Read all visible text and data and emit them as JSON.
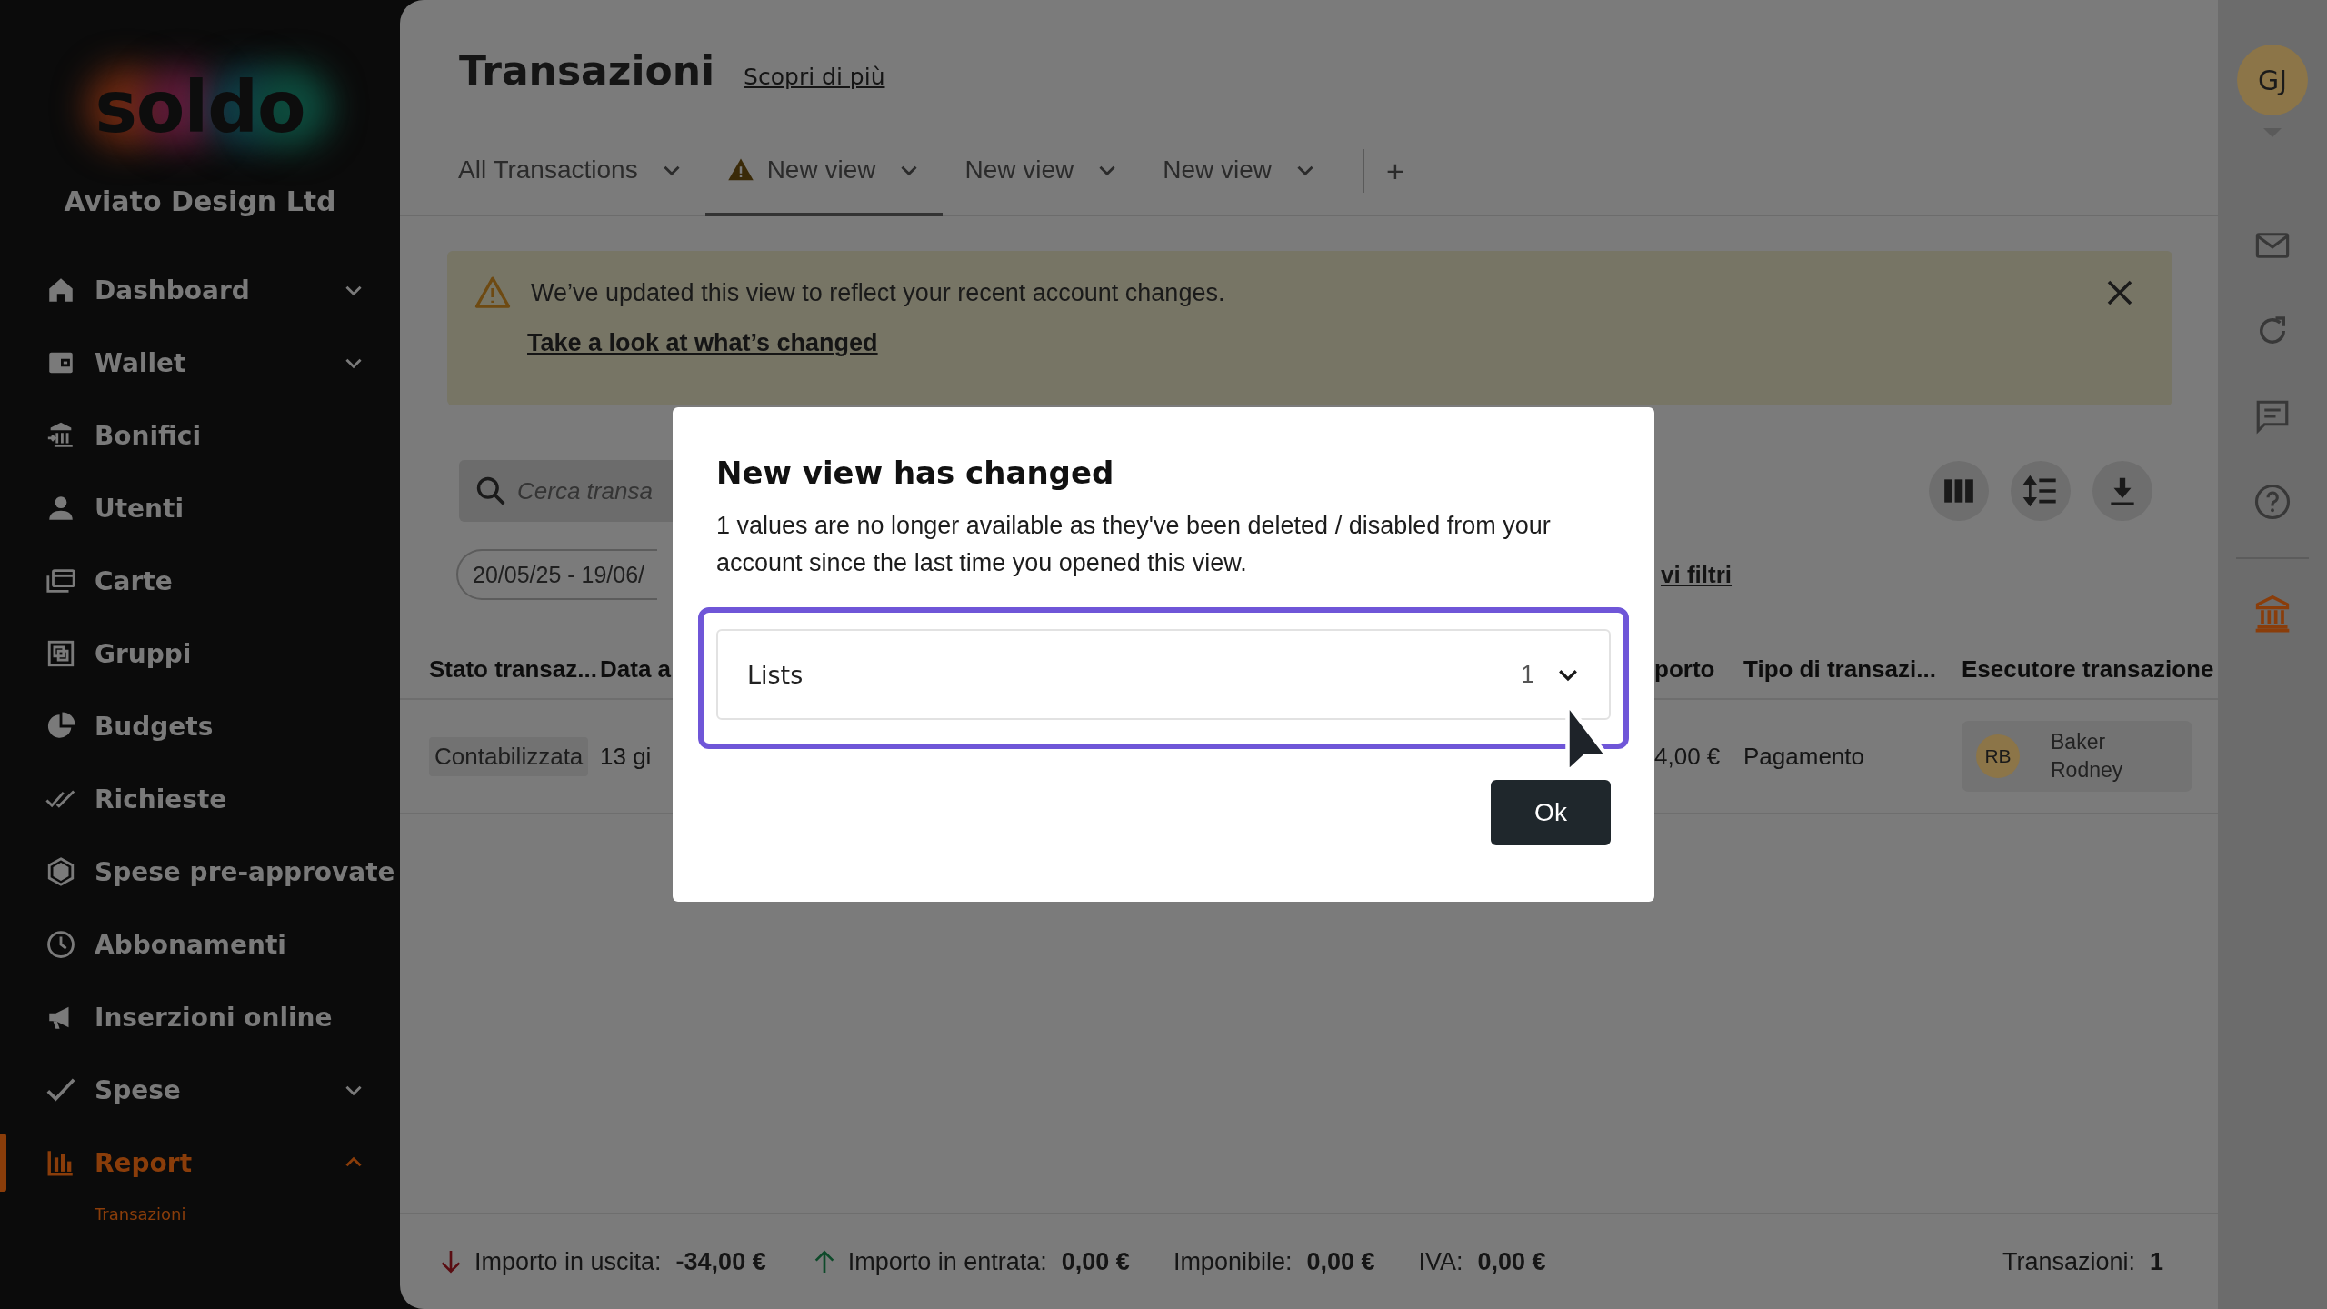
{
  "sidebar": {
    "logo": "soldo",
    "company": "Aviato Design Ltd",
    "items": [
      {
        "label": "Dashboard",
        "kind": "group",
        "expanded": false,
        "selected": false
      },
      {
        "label": "Wallet",
        "kind": "group",
        "expanded": false,
        "selected": false
      },
      {
        "label": "Bonifici",
        "kind": "link",
        "selected": false
      },
      {
        "label": "Utenti",
        "kind": "link",
        "selected": false
      },
      {
        "label": "Carte",
        "kind": "link",
        "selected": false
      },
      {
        "label": "Gruppi",
        "kind": "link",
        "selected": false
      },
      {
        "label": "Budgets",
        "kind": "link",
        "selected": false
      },
      {
        "label": "Richieste",
        "kind": "link",
        "selected": false
      },
      {
        "label": "Spese pre-approvate",
        "kind": "link",
        "selected": false
      },
      {
        "label": "Abbonamenti",
        "kind": "link",
        "selected": false
      },
      {
        "label": "Inserzioni online",
        "kind": "link",
        "selected": false
      },
      {
        "label": "Spese",
        "kind": "group",
        "expanded": false,
        "selected": false
      },
      {
        "label": "Report",
        "kind": "group",
        "expanded": true,
        "selected": true,
        "children": [
          {
            "label": "Transazioni",
            "selected": true
          }
        ]
      }
    ]
  },
  "header": {
    "title": "Transazioni",
    "link": "Scopri di più"
  },
  "tabs": [
    {
      "label": "All Transactions",
      "selected": false,
      "warning": false
    },
    {
      "label": "New view",
      "selected": true,
      "warning": true
    },
    {
      "label": "New view",
      "selected": false,
      "warning": false
    },
    {
      "label": "New view",
      "selected": false,
      "warning": false
    }
  ],
  "add_tab": "+",
  "banner": {
    "message": "We’ve updated this view to reflect your recent account changes.",
    "link": "Take a look at what’s changed"
  },
  "search": {
    "placeholder": "Cerca transa"
  },
  "date_range": "20/05/25 - 19/06/",
  "filters_link": "vi filtri",
  "table": {
    "columns": [
      "Stato transaz...",
      "Data a",
      "porto",
      "Tipo di transazi...",
      "Esecutore transazione"
    ],
    "rows": [
      {
        "status": "Contabilizzata",
        "date": "13 gi",
        "amount": "4,00 €",
        "type": "Pagamento",
        "executor": {
          "initials": "RB",
          "name": "Baker Rodney"
        }
      }
    ]
  },
  "footer": {
    "totals": [
      {
        "kind": "out",
        "label": "Importo in uscita:",
        "value": "-34,00 €"
      },
      {
        "kind": "in",
        "label": "Importo in entrata:",
        "value": "0,00 €"
      },
      {
        "kind": "plain",
        "label": "Imponibile:",
        "value": "0,00 €"
      },
      {
        "kind": "plain",
        "label": "IVA:",
        "value": "0,00 €"
      }
    ],
    "count": {
      "label": "Transazioni:",
      "value": "1"
    }
  },
  "rail": {
    "avatar": "GJ"
  },
  "modal": {
    "title": "New view has changed",
    "body": "1 values are no longer available as they've been deleted / disabled from your account since the last time you opened this view.",
    "group": {
      "label": "Lists",
      "count": "1",
      "expanded": false
    },
    "ok": "Ok"
  }
}
